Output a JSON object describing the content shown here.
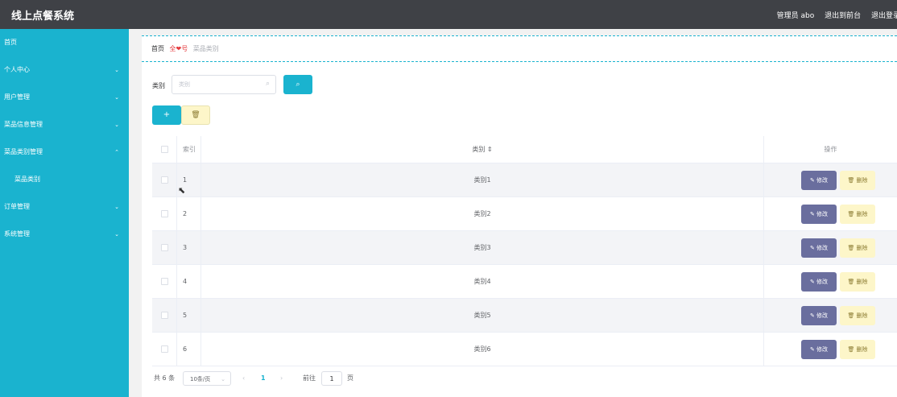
{
  "header": {
    "title": "线上点餐系统",
    "admin": "管理员 abo",
    "back_front": "退出到前台",
    "logout": "退出登录"
  },
  "sidebar": {
    "items": [
      {
        "label": "首页",
        "chevron": ""
      },
      {
        "label": "个人中心",
        "chevron": "⌄"
      },
      {
        "label": "用户管理",
        "chevron": "⌄"
      },
      {
        "label": "菜品信息管理",
        "chevron": "⌄"
      },
      {
        "label": "菜品类别管理",
        "chevron": "⌃"
      },
      {
        "label": "菜品类别",
        "chevron": ""
      },
      {
        "label": "订单管理",
        "chevron": "⌄"
      },
      {
        "label": "系统管理",
        "chevron": "⌄"
      }
    ]
  },
  "breadcrumb": {
    "home": "首页",
    "separator": "全❤号",
    "current": "菜品类别"
  },
  "search": {
    "label": "类别",
    "placeholder": "类别"
  },
  "table": {
    "headers": {
      "index": "索引",
      "category": "类别 ⇕",
      "actions": "操作"
    },
    "edit_label": "✎ 修改",
    "delete_label": "🗑 删除",
    "rows": [
      {
        "index": "1",
        "category": "类别1"
      },
      {
        "index": "2",
        "category": "类别2"
      },
      {
        "index": "3",
        "category": "类别3"
      },
      {
        "index": "4",
        "category": "类别4"
      },
      {
        "index": "5",
        "category": "类别5"
      },
      {
        "index": "6",
        "category": "类别6"
      }
    ]
  },
  "pagination": {
    "total": "共 6 条",
    "page_size": "10条/页",
    "current_page": "1",
    "goto_label": "前往",
    "goto_value": "1",
    "page_unit": "页"
  },
  "colors": {
    "accent": "#1ab3cf",
    "header_bg": "#3f4146",
    "edit_button": "#6a6e9e",
    "delete_button": "#fdf6c9"
  }
}
